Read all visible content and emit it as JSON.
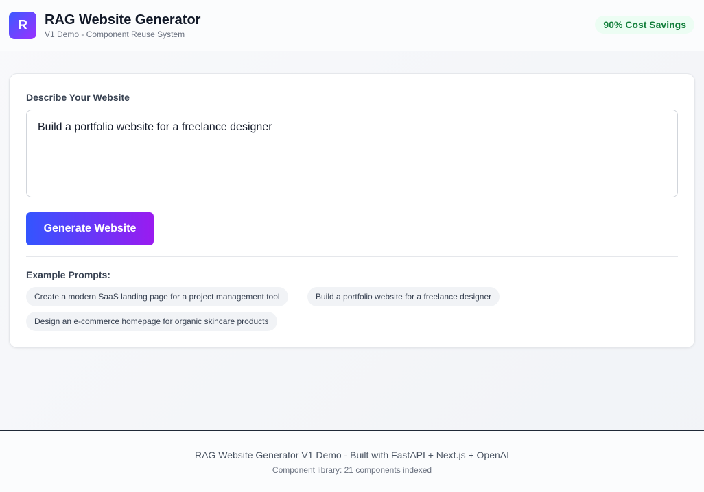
{
  "header": {
    "logo_letter": "R",
    "title": "RAG Website Generator",
    "subtitle": "V1 Demo - Component Reuse System",
    "badge": "90% Cost Savings"
  },
  "form": {
    "label": "Describe Your Website",
    "input_value": "Build a portfolio website for a freelance designer",
    "button_label": "Generate Website"
  },
  "examples": {
    "label": "Example Prompts:",
    "items": [
      "Create a modern SaaS landing page for a project management tool",
      "Build a portfolio website for a freelance designer",
      "Design an e-commerce homepage for organic skincare products"
    ]
  },
  "footer": {
    "main": "RAG Website Generator V1 Demo - Built with FastAPI + Next.js + OpenAI",
    "sub": "Component library: 21 components indexed"
  }
}
